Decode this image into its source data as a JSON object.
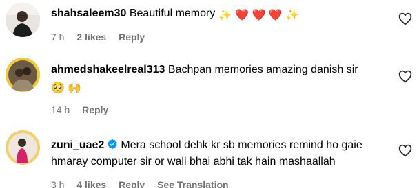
{
  "comments": [
    {
      "username": "shahsaleem30",
      "text": "Beautiful memory",
      "emoji": "✨ ❤️ ❤️ ❤️ ✨",
      "time": "7 h",
      "likes": "2 likes",
      "reply": "Reply"
    },
    {
      "username": "ahmedshakeelreal313",
      "text": "Bachpan memories amazing danish sir",
      "emoji_line2": "🥺 🙌",
      "time": "14 h",
      "reply": "Reply"
    },
    {
      "username": "zuni_uae2",
      "verified": true,
      "text_line1": "Mera school dehk kr sb memories remind ho gaie",
      "text_line2": "hmaray computer sir or wali bhai abhi tak hain mashaallah",
      "time": "3 h",
      "likes": "4 likes",
      "reply": "Reply",
      "see_translation": "See Translation"
    }
  ],
  "colors": {
    "meta_text": "#737373",
    "verified": "#0095f6",
    "heart_red": "#ed1c3f"
  },
  "icons": [
    "like-heart-icon",
    "verified-badge-icon"
  ]
}
